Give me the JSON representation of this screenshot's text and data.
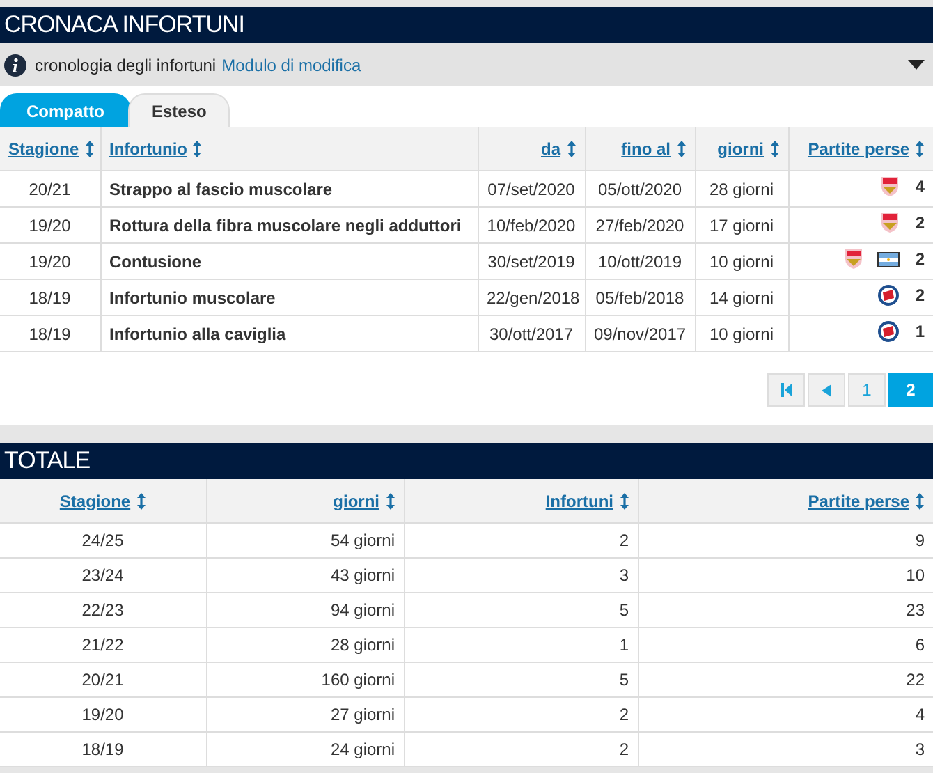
{
  "section_title": "CRONACA INFORTUNI",
  "info_bar": {
    "text": "cronologia degli infortuni",
    "link": "Modulo di modifica"
  },
  "tabs": [
    {
      "label": "Compatto",
      "selected": true
    },
    {
      "label": "Esteso",
      "selected": false
    }
  ],
  "injuries": {
    "columns": [
      "Stagione",
      "Infortunio",
      "da",
      "fino al",
      "giorni",
      "Partite perse"
    ],
    "rows": [
      {
        "season": "20/21",
        "injury": "Strappo al fascio muscolare",
        "from": "07/set/2020",
        "until": "05/ott/2020",
        "days": "28 giorni",
        "clubs": [
          {
            "kind": "shield"
          }
        ],
        "missed": "4"
      },
      {
        "season": "19/20",
        "injury": "Rottura della fibra muscolare negli adduttori",
        "from": "10/feb/2020",
        "until": "27/feb/2020",
        "days": "17 giorni",
        "clubs": [
          {
            "kind": "shield"
          }
        ],
        "missed": "2"
      },
      {
        "season": "19/20",
        "injury": "Contusione",
        "from": "30/set/2019",
        "until": "10/ott/2019",
        "days": "10 giorni",
        "clubs": [
          {
            "kind": "shield"
          },
          {
            "kind": "flag"
          }
        ],
        "missed": "2"
      },
      {
        "season": "18/19",
        "injury": "Infortunio muscolare",
        "from": "22/gen/2018",
        "until": "05/feb/2018",
        "days": "14 giorni",
        "clubs": [
          {
            "kind": "roundel"
          }
        ],
        "missed": "2"
      },
      {
        "season": "18/19",
        "injury": "Infortunio alla caviglia",
        "from": "30/ott/2017",
        "until": "09/nov/2017",
        "days": "10 giorni",
        "clubs": [
          {
            "kind": "roundel"
          }
        ],
        "missed": "1"
      }
    ]
  },
  "pagination": [
    {
      "kind": "first",
      "selected": false
    },
    {
      "kind": "prev",
      "selected": false
    },
    {
      "kind": "page",
      "label": "1",
      "selected": false
    },
    {
      "kind": "page",
      "label": "2",
      "selected": true
    }
  ],
  "totals_title": "TOTALE",
  "totals": {
    "columns": [
      "Stagione",
      "giorni",
      "Infortuni",
      "Partite perse"
    ],
    "rows": [
      [
        "24/25",
        "54 giorni",
        "2",
        "9"
      ],
      [
        "23/24",
        "43 giorni",
        "3",
        "10"
      ],
      [
        "22/23",
        "94 giorni",
        "5",
        "23"
      ],
      [
        "21/22",
        "28 giorni",
        "1",
        "6"
      ],
      [
        "20/21",
        "160 giorni",
        "5",
        "22"
      ],
      [
        "19/20",
        "27 giorni",
        "2",
        "4"
      ],
      [
        "18/19",
        "24 giorni",
        "2",
        "3"
      ]
    ]
  }
}
